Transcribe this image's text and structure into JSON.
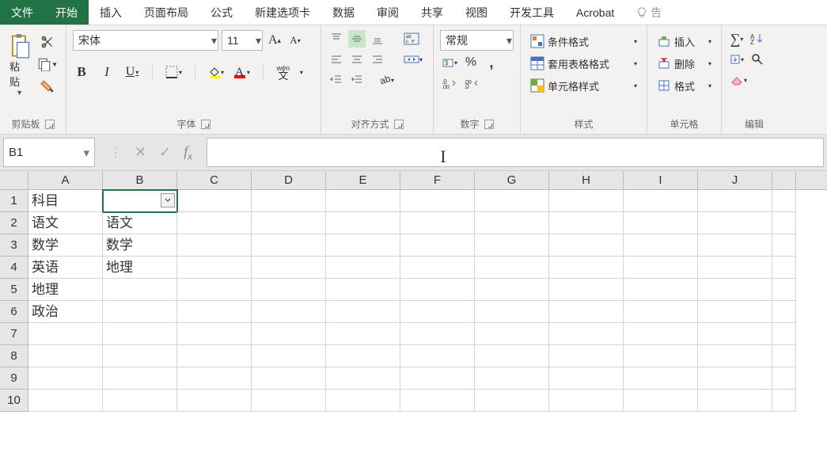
{
  "menu": {
    "file": "文件",
    "home": "开始",
    "insert": "插入",
    "layout": "页面布局",
    "formulas": "公式",
    "newtab": "新建选项卡",
    "data": "数据",
    "review": "审阅",
    "share": "共享",
    "view": "视图",
    "dev": "开发工具",
    "acrobat": "Acrobat",
    "tell": "告"
  },
  "ribbon": {
    "clipboard": {
      "paste": "粘贴",
      "label": "剪贴板"
    },
    "font": {
      "name": "宋体",
      "size": "11",
      "label": "字体",
      "wen": "wén",
      "wen2": "文"
    },
    "align": {
      "label": "对齐方式"
    },
    "number": {
      "format": "常规",
      "label": "数字"
    },
    "styles": {
      "cond": "条件格式",
      "table": "套用表格格式",
      "cell": "单元格样式",
      "label": "样式"
    },
    "cells": {
      "insert": "插入",
      "delete": "删除",
      "format": "格式",
      "label": "单元格"
    },
    "editing": {
      "label": "编辑"
    }
  },
  "formula": {
    "namebox": "B1"
  },
  "grid": {
    "cols": [
      "A",
      "B",
      "C",
      "D",
      "E",
      "F",
      "G",
      "H",
      "I",
      "J"
    ],
    "rows": [
      "1",
      "2",
      "3",
      "4",
      "5",
      "6",
      "7",
      "8",
      "9",
      "10"
    ],
    "data": {
      "A1": "科目",
      "A2": "语文",
      "A3": "数学",
      "A4": "英语",
      "A5": "地理",
      "A6": "政治",
      "B2": "语文",
      "B3": "数学",
      "B4": "地理"
    },
    "selected": "B1",
    "filter_cell": "B1"
  }
}
